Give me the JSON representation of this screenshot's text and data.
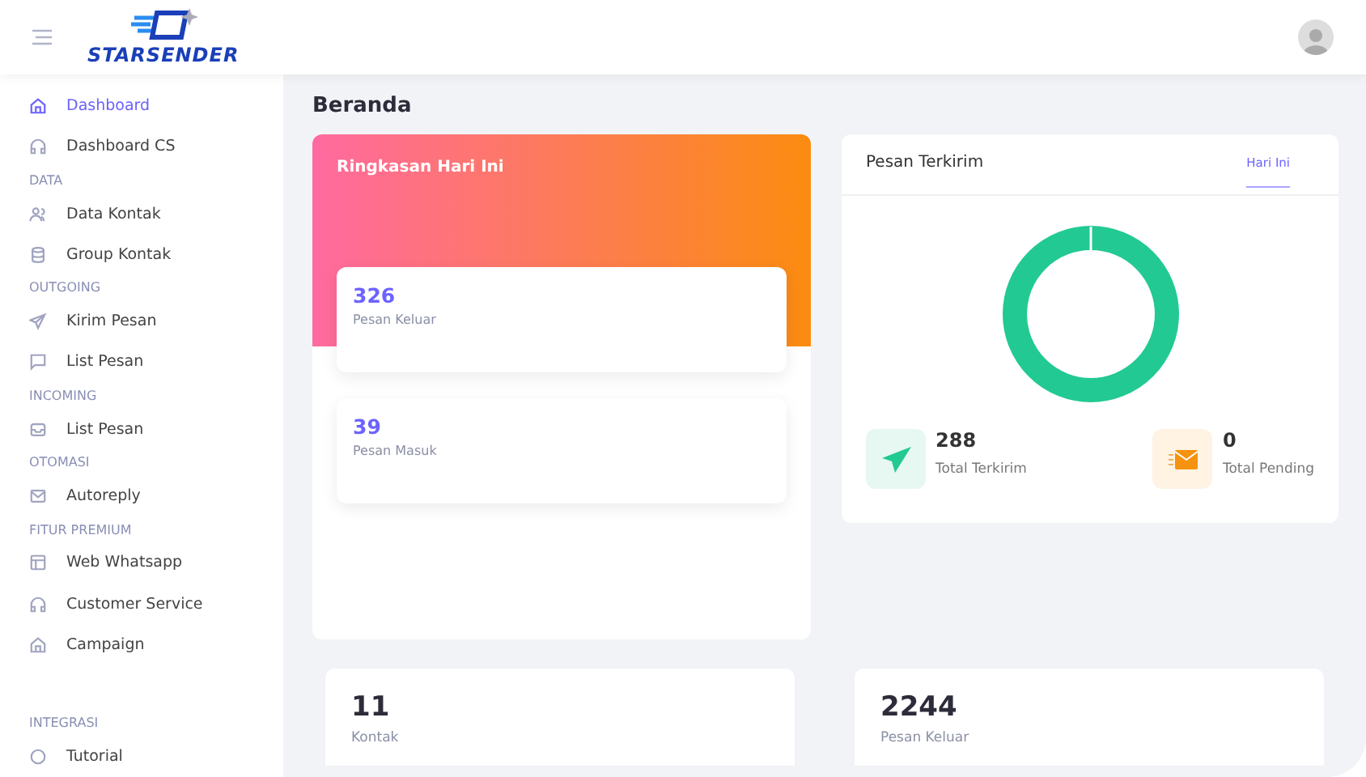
{
  "header": {
    "logo": "STARSENDER"
  },
  "sidebar": {
    "groups": [
      {
        "items": [
          {
            "label": "Dashboard",
            "selected": true
          },
          {
            "label": "Dashboard CS",
            "selected": false
          }
        ]
      },
      {
        "title": "DATA",
        "items": [
          {
            "label": "Data Kontak",
            "selected": false
          },
          {
            "label": "Group Kontak",
            "selected": false
          }
        ]
      },
      {
        "title": "OUTGOING",
        "items": [
          {
            "label": "Kirim Pesan",
            "selected": false
          },
          {
            "label": "List Pesan",
            "selected": false
          }
        ]
      },
      {
        "title": "INCOMING",
        "items": [
          {
            "label": "List Pesan",
            "selected": false
          }
        ]
      },
      {
        "title": "OTOMASI",
        "items": [
          {
            "label": "Autoreply",
            "selected": false
          }
        ]
      },
      {
        "title": "FITUR PREMIUM",
        "items": [
          {
            "label": "Web Whatsapp",
            "selected": false
          },
          {
            "label": "Customer Service",
            "selected": false
          },
          {
            "label": "Campaign",
            "selected": false
          }
        ]
      },
      {
        "title": "INTEGRASI",
        "items": [
          {
            "label": "Tutorial",
            "selected": false
          }
        ]
      }
    ]
  },
  "page_title": "Beranda",
  "summary": {
    "title": "Ringkasan Hari Ini",
    "stats": [
      {
        "value": "326",
        "label": "Pesan Keluar"
      },
      {
        "value": "39",
        "label": "Pesan Masuk"
      }
    ]
  },
  "sent": {
    "title": "Pesan Terkirim",
    "tabs": [
      {
        "label": "Hari Ini",
        "selected": true
      }
    ],
    "totals": [
      {
        "kind": "sent",
        "value": "288",
        "label": "Total Terkirim"
      },
      {
        "kind": "pending",
        "value": "0",
        "label": "Total Pending"
      }
    ]
  },
  "cards": [
    {
      "value": "11",
      "label": "Kontak"
    },
    {
      "value": "2244",
      "label": "Pesan Keluar"
    }
  ]
}
